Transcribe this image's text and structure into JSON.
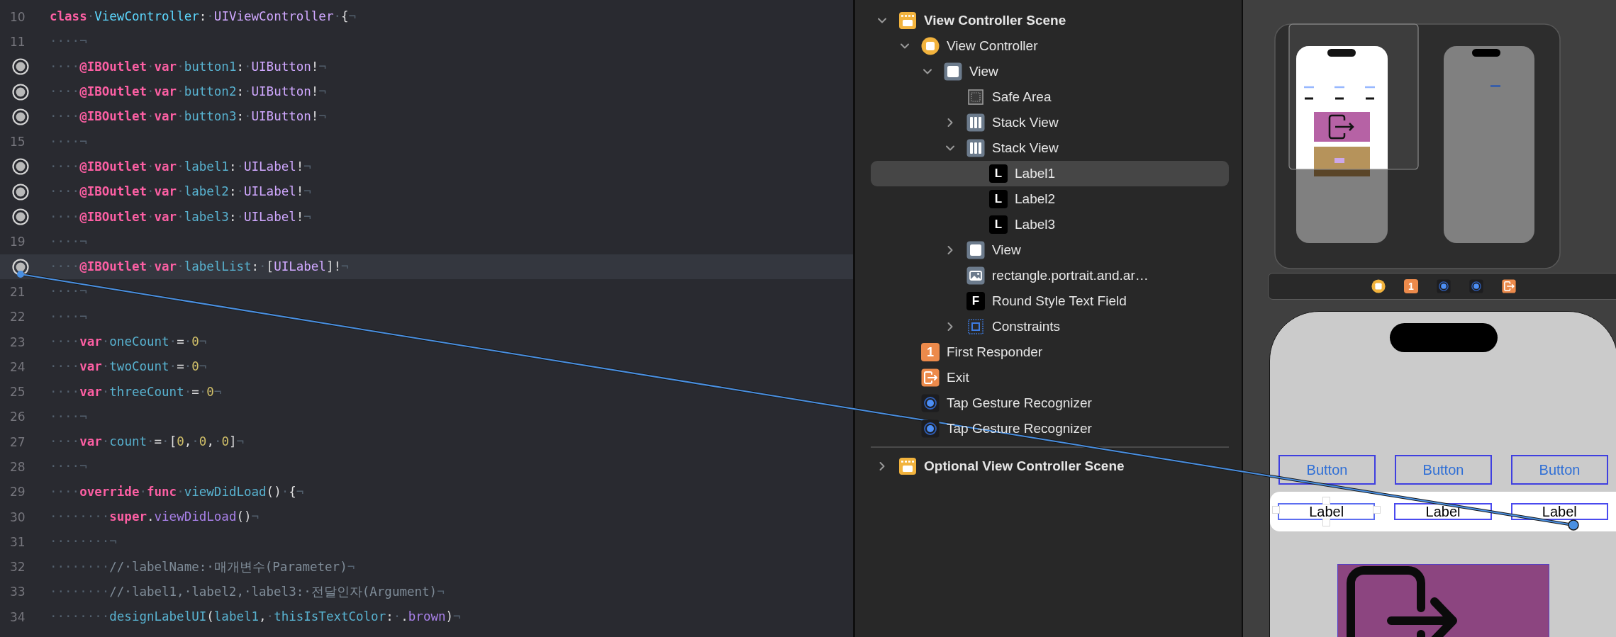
{
  "editor": {
    "lines": [
      {
        "number": "10",
        "outlet": false,
        "tokens": [
          {
            "kind": "keyword",
            "text": "class"
          },
          {
            "kind": "invisible",
            "text": "·"
          },
          {
            "kind": "declaration",
            "text": "ViewController"
          },
          {
            "kind": "plain",
            "text": ":"
          },
          {
            "kind": "invisible",
            "text": "·"
          },
          {
            "kind": "type",
            "text": "UIViewController"
          },
          {
            "kind": "invisible",
            "text": "·"
          },
          {
            "kind": "plain",
            "text": "{"
          },
          {
            "kind": "invisible",
            "text": "¬"
          }
        ]
      },
      {
        "number": "11",
        "outlet": false,
        "tokens": [
          {
            "kind": "invisible",
            "text": "····¬"
          }
        ]
      },
      {
        "outlet": true,
        "tokens": [
          {
            "kind": "invisible",
            "text": "····"
          },
          {
            "kind": "keyword",
            "text": "@IBOutlet"
          },
          {
            "kind": "invisible",
            "text": "·"
          },
          {
            "kind": "keyword",
            "text": "var"
          },
          {
            "kind": "invisible",
            "text": "·"
          },
          {
            "kind": "identifier",
            "text": "button1"
          },
          {
            "kind": "plain",
            "text": ":"
          },
          {
            "kind": "invisible",
            "text": "·"
          },
          {
            "kind": "type",
            "text": "UIButton"
          },
          {
            "kind": "plain",
            "text": "!"
          },
          {
            "kind": "invisible",
            "text": "¬"
          }
        ]
      },
      {
        "outlet": true,
        "tokens": [
          {
            "kind": "invisible",
            "text": "····"
          },
          {
            "kind": "keyword",
            "text": "@IBOutlet"
          },
          {
            "kind": "invisible",
            "text": "·"
          },
          {
            "kind": "keyword",
            "text": "var"
          },
          {
            "kind": "invisible",
            "text": "·"
          },
          {
            "kind": "identifier",
            "text": "button2"
          },
          {
            "kind": "plain",
            "text": ":"
          },
          {
            "kind": "invisible",
            "text": "·"
          },
          {
            "kind": "type",
            "text": "UIButton"
          },
          {
            "kind": "plain",
            "text": "!"
          },
          {
            "kind": "invisible",
            "text": "¬"
          }
        ]
      },
      {
        "outlet": true,
        "tokens": [
          {
            "kind": "invisible",
            "text": "····"
          },
          {
            "kind": "keyword",
            "text": "@IBOutlet"
          },
          {
            "kind": "invisible",
            "text": "·"
          },
          {
            "kind": "keyword",
            "text": "var"
          },
          {
            "kind": "invisible",
            "text": "·"
          },
          {
            "kind": "identifier",
            "text": "button3"
          },
          {
            "kind": "plain",
            "text": ":"
          },
          {
            "kind": "invisible",
            "text": "·"
          },
          {
            "kind": "type",
            "text": "UIButton"
          },
          {
            "kind": "plain",
            "text": "!"
          },
          {
            "kind": "invisible",
            "text": "¬"
          }
        ]
      },
      {
        "number": "15",
        "outlet": false,
        "tokens": [
          {
            "kind": "invisible",
            "text": "····¬"
          }
        ]
      },
      {
        "outlet": true,
        "tokens": [
          {
            "kind": "invisible",
            "text": "····"
          },
          {
            "kind": "keyword",
            "text": "@IBOutlet"
          },
          {
            "kind": "invisible",
            "text": "·"
          },
          {
            "kind": "keyword",
            "text": "var"
          },
          {
            "kind": "invisible",
            "text": "·"
          },
          {
            "kind": "identifier",
            "text": "label1"
          },
          {
            "kind": "plain",
            "text": ":"
          },
          {
            "kind": "invisible",
            "text": "·"
          },
          {
            "kind": "type",
            "text": "UILabel"
          },
          {
            "kind": "plain",
            "text": "!"
          },
          {
            "kind": "invisible",
            "text": "¬"
          }
        ]
      },
      {
        "outlet": true,
        "tokens": [
          {
            "kind": "invisible",
            "text": "····"
          },
          {
            "kind": "keyword",
            "text": "@IBOutlet"
          },
          {
            "kind": "invisible",
            "text": "·"
          },
          {
            "kind": "keyword",
            "text": "var"
          },
          {
            "kind": "invisible",
            "text": "·"
          },
          {
            "kind": "identifier",
            "text": "label2"
          },
          {
            "kind": "plain",
            "text": ":"
          },
          {
            "kind": "invisible",
            "text": "·"
          },
          {
            "kind": "type",
            "text": "UILabel"
          },
          {
            "kind": "plain",
            "text": "!"
          },
          {
            "kind": "invisible",
            "text": "¬"
          }
        ]
      },
      {
        "outlet": true,
        "tokens": [
          {
            "kind": "invisible",
            "text": "····"
          },
          {
            "kind": "keyword",
            "text": "@IBOutlet"
          },
          {
            "kind": "invisible",
            "text": "·"
          },
          {
            "kind": "keyword",
            "text": "var"
          },
          {
            "kind": "invisible",
            "text": "·"
          },
          {
            "kind": "identifier",
            "text": "label3"
          },
          {
            "kind": "plain",
            "text": ":"
          },
          {
            "kind": "invisible",
            "text": "·"
          },
          {
            "kind": "type",
            "text": "UILabel"
          },
          {
            "kind": "plain",
            "text": "!"
          },
          {
            "kind": "invisible",
            "text": "¬"
          }
        ]
      },
      {
        "number": "19",
        "outlet": false,
        "tokens": [
          {
            "kind": "invisible",
            "text": "····¬"
          }
        ]
      },
      {
        "outlet": true,
        "current": true,
        "tokens": [
          {
            "kind": "invisible",
            "text": "····"
          },
          {
            "kind": "keyword",
            "text": "@IBOutlet"
          },
          {
            "kind": "invisible",
            "text": "·"
          },
          {
            "kind": "keyword",
            "text": "var"
          },
          {
            "kind": "invisible",
            "text": "·"
          },
          {
            "kind": "identifier",
            "text": "labelList"
          },
          {
            "kind": "plain",
            "text": ":"
          },
          {
            "kind": "invisible",
            "text": "·"
          },
          {
            "kind": "plain",
            "text": "["
          },
          {
            "kind": "type",
            "text": "UILabel"
          },
          {
            "kind": "plain",
            "text": "]!"
          },
          {
            "kind": "invisible",
            "text": "¬"
          }
        ]
      },
      {
        "number": "21",
        "outlet": false,
        "tokens": [
          {
            "kind": "invisible",
            "text": "····¬"
          }
        ]
      },
      {
        "number": "22",
        "outlet": false,
        "tokens": [
          {
            "kind": "invisible",
            "text": "····¬"
          }
        ]
      },
      {
        "number": "23",
        "outlet": false,
        "tokens": [
          {
            "kind": "invisible",
            "text": "····"
          },
          {
            "kind": "keyword",
            "text": "var"
          },
          {
            "kind": "invisible",
            "text": "·"
          },
          {
            "kind": "identifier",
            "text": "oneCount"
          },
          {
            "kind": "invisible",
            "text": "·"
          },
          {
            "kind": "plain",
            "text": "="
          },
          {
            "kind": "invisible",
            "text": "·"
          },
          {
            "kind": "number",
            "text": "0"
          },
          {
            "kind": "invisible",
            "text": "¬"
          }
        ]
      },
      {
        "number": "24",
        "outlet": false,
        "tokens": [
          {
            "kind": "invisible",
            "text": "····"
          },
          {
            "kind": "keyword",
            "text": "var"
          },
          {
            "kind": "invisible",
            "text": "·"
          },
          {
            "kind": "identifier",
            "text": "twoCount"
          },
          {
            "kind": "invisible",
            "text": "·"
          },
          {
            "kind": "plain",
            "text": "="
          },
          {
            "kind": "invisible",
            "text": "·"
          },
          {
            "kind": "number",
            "text": "0"
          },
          {
            "kind": "invisible",
            "text": "¬"
          }
        ]
      },
      {
        "number": "25",
        "outlet": false,
        "tokens": [
          {
            "kind": "invisible",
            "text": "····"
          },
          {
            "kind": "keyword",
            "text": "var"
          },
          {
            "kind": "invisible",
            "text": "·"
          },
          {
            "kind": "identifier",
            "text": "threeCount"
          },
          {
            "kind": "invisible",
            "text": "·"
          },
          {
            "kind": "plain",
            "text": "="
          },
          {
            "kind": "invisible",
            "text": "·"
          },
          {
            "kind": "number",
            "text": "0"
          },
          {
            "kind": "invisible",
            "text": "¬"
          }
        ]
      },
      {
        "number": "26",
        "outlet": false,
        "tokens": [
          {
            "kind": "invisible",
            "text": "····¬"
          }
        ]
      },
      {
        "number": "27",
        "outlet": false,
        "tokens": [
          {
            "kind": "invisible",
            "text": "····"
          },
          {
            "kind": "keyword",
            "text": "var"
          },
          {
            "kind": "invisible",
            "text": "·"
          },
          {
            "kind": "identifier",
            "text": "count"
          },
          {
            "kind": "invisible",
            "text": "·"
          },
          {
            "kind": "plain",
            "text": "="
          },
          {
            "kind": "invisible",
            "text": "·"
          },
          {
            "kind": "plain",
            "text": "["
          },
          {
            "kind": "number",
            "text": "0"
          },
          {
            "kind": "plain",
            "text": ","
          },
          {
            "kind": "invisible",
            "text": "·"
          },
          {
            "kind": "number",
            "text": "0"
          },
          {
            "kind": "plain",
            "text": ","
          },
          {
            "kind": "invisible",
            "text": "·"
          },
          {
            "kind": "number",
            "text": "0"
          },
          {
            "kind": "plain",
            "text": "]"
          },
          {
            "kind": "invisible",
            "text": "¬"
          }
        ]
      },
      {
        "number": "28",
        "outlet": false,
        "tokens": [
          {
            "kind": "invisible",
            "text": "····¬"
          }
        ]
      },
      {
        "number": "29",
        "outlet": false,
        "tokens": [
          {
            "kind": "invisible",
            "text": "····"
          },
          {
            "kind": "keyword",
            "text": "override"
          },
          {
            "kind": "invisible",
            "text": "·"
          },
          {
            "kind": "keyword",
            "text": "func"
          },
          {
            "kind": "invisible",
            "text": "·"
          },
          {
            "kind": "identifier",
            "text": "viewDidLoad"
          },
          {
            "kind": "plain",
            "text": "()"
          },
          {
            "kind": "invisible",
            "text": "·"
          },
          {
            "kind": "plain",
            "text": "{"
          },
          {
            "kind": "invisible",
            "text": "¬"
          }
        ]
      },
      {
        "number": "30",
        "outlet": false,
        "tokens": [
          {
            "kind": "invisible",
            "text": "········"
          },
          {
            "kind": "keyword",
            "text": "super"
          },
          {
            "kind": "plain",
            "text": "."
          },
          {
            "kind": "method",
            "text": "viewDidLoad"
          },
          {
            "kind": "plain",
            "text": "()"
          },
          {
            "kind": "invisible",
            "text": "¬"
          }
        ]
      },
      {
        "number": "31",
        "outlet": false,
        "tokens": [
          {
            "kind": "invisible",
            "text": "········¬"
          }
        ]
      },
      {
        "number": "32",
        "outlet": false,
        "tokens": [
          {
            "kind": "invisible",
            "text": "········"
          },
          {
            "kind": "comment",
            "text": "//·labelName:·매개변수(Parameter)"
          },
          {
            "kind": "invisible",
            "text": "¬"
          }
        ]
      },
      {
        "number": "33",
        "outlet": false,
        "tokens": [
          {
            "kind": "invisible",
            "text": "········"
          },
          {
            "kind": "comment",
            "text": "//·label1,·label2,·label3:·전달인자(Argument)"
          },
          {
            "kind": "invisible",
            "text": "¬"
          }
        ]
      },
      {
        "number": "34",
        "outlet": false,
        "tokens": [
          {
            "kind": "invisible",
            "text": "········"
          },
          {
            "kind": "identifier",
            "text": "designLabelUI"
          },
          {
            "kind": "plain",
            "text": "("
          },
          {
            "kind": "identifier",
            "text": "label1"
          },
          {
            "kind": "plain",
            "text": ","
          },
          {
            "kind": "invisible",
            "text": "·"
          },
          {
            "kind": "identifier",
            "text": "thisIsTextColor"
          },
          {
            "kind": "plain",
            "text": ":"
          },
          {
            "kind": "invisible",
            "text": "·"
          },
          {
            "kind": "plain",
            "text": "."
          },
          {
            "kind": "method",
            "text": "brown"
          },
          {
            "kind": "plain",
            "text": ")"
          },
          {
            "kind": "invisible",
            "text": "¬"
          }
        ]
      }
    ]
  },
  "outline": {
    "scenes": [
      {
        "label": "View Controller Scene",
        "icon": {
          "kind": "scene"
        },
        "expanded": true,
        "selected": false,
        "children": [
          {
            "label": "View Controller",
            "icon": {
              "kind": "controller"
            },
            "expanded": true,
            "selected": false,
            "children": [
              {
                "label": "View",
                "icon": {
                  "kind": "view"
                },
                "expanded": true,
                "selected": false,
                "children": [
                  {
                    "label": "Safe Area",
                    "icon": {
                      "kind": "safe-area"
                    },
                    "selected": false
                  },
                  {
                    "label": "Stack View",
                    "icon": {
                      "kind": "stack"
                    },
                    "expanded": false,
                    "selected": false
                  },
                  {
                    "label": "Stack View",
                    "icon": {
                      "kind": "stack"
                    },
                    "expanded": true,
                    "selected": false,
                    "children": [
                      {
                        "label": "Label1",
                        "icon": {
                          "kind": "label",
                          "glyph": "L"
                        },
                        "selected": true
                      },
                      {
                        "label": "Label2",
                        "icon": {
                          "kind": "label",
                          "glyph": "L"
                        },
                        "selected": false
                      },
                      {
                        "label": "Label3",
                        "icon": {
                          "kind": "label",
                          "glyph": "L"
                        },
                        "selected": false
                      }
                    ]
                  },
                  {
                    "label": "View",
                    "icon": {
                      "kind": "view"
                    },
                    "expanded": false,
                    "selected": false
                  },
                  {
                    "label": "rectangle.portrait.and.ar…",
                    "icon": {
                      "kind": "image"
                    },
                    "selected": false
                  },
                  {
                    "label": "Round Style Text Field",
                    "icon": {
                      "kind": "text-field",
                      "glyph": "F"
                    },
                    "selected": false
                  },
                  {
                    "label": "Constraints",
                    "icon": {
                      "kind": "constraints"
                    },
                    "expanded": false,
                    "selected": false
                  }
                ]
              }
            ]
          },
          {
            "label": "First Responder",
            "icon": {
              "kind": "first-responder",
              "glyph": "1"
            },
            "selected": false
          },
          {
            "label": "Exit",
            "icon": {
              "kind": "exit"
            },
            "selected": false
          },
          {
            "label": "Tap Gesture Recognizer",
            "icon": {
              "kind": "gesture"
            },
            "selected": false
          },
          {
            "label": "Tap Gesture Recognizer",
            "icon": {
              "kind": "gesture"
            },
            "selected": false
          }
        ]
      },
      {
        "label": "Optional View Controller Scene",
        "icon": {
          "kind": "scene"
        },
        "expanded": false,
        "selected": false
      }
    ]
  },
  "canvas": {
    "dock": [
      {
        "kind": "controller"
      },
      {
        "kind": "first-responder",
        "glyph": "1"
      },
      {
        "kind": "gesture"
      },
      {
        "kind": "gesture"
      },
      {
        "kind": "exit"
      }
    ],
    "phone": {
      "buttons": [
        {
          "label": "Button"
        },
        {
          "label": "Button"
        },
        {
          "label": "Button"
        }
      ],
      "labels": [
        {
          "text": "Label",
          "selected": true
        },
        {
          "text": "Label",
          "selected": false
        },
        {
          "text": "Label",
          "selected": false
        }
      ]
    }
  }
}
